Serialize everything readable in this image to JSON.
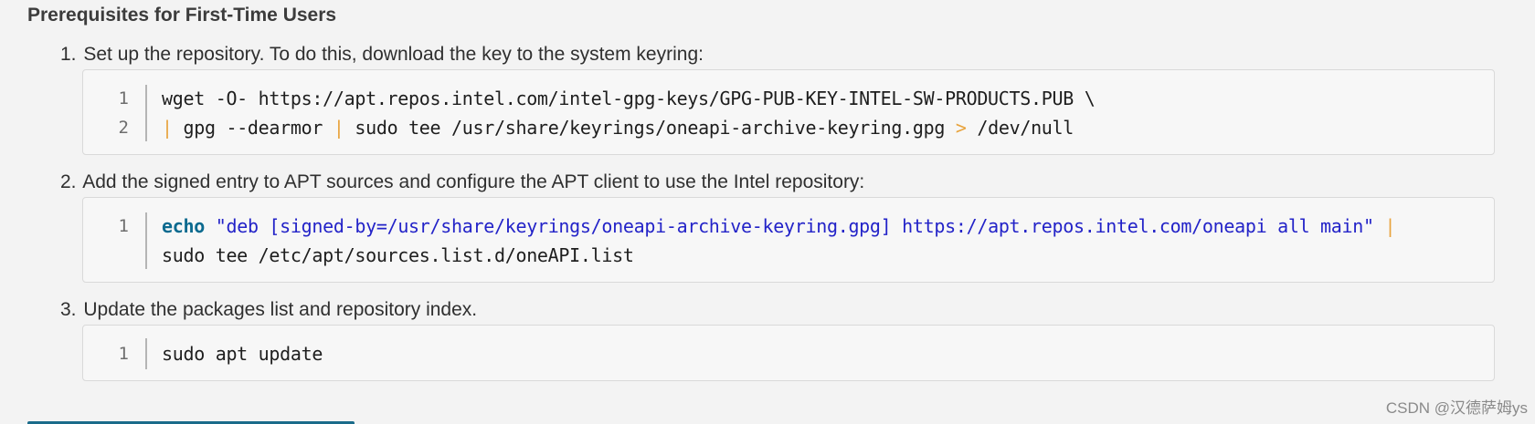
{
  "section": {
    "title": "Prerequisites for First-Time Users"
  },
  "steps": [
    {
      "number": "1.",
      "text": "Set up the repository. To do this, download the key to the system keyring:",
      "code": [
        {
          "ln": "1",
          "parts": [
            "wget -O- https://apt.repos.intel.com/intel-gpg-keys/GPG-PUB-KEY-INTEL-SW-PRODUCTS.PUB \\"
          ]
        },
        {
          "ln": "2",
          "parts": [
            "|",
            " gpg --dearmor ",
            "|",
            " sudo tee /usr/share/keyrings/oneapi-archive-keyring.gpg ",
            ">",
            " /dev/null"
          ]
        }
      ]
    },
    {
      "number": "2.",
      "text": "Add the signed entry to APT sources and configure the APT client to use the Intel repository:",
      "code": [
        {
          "ln": "1",
          "parts": [
            "echo",
            " ",
            "\"deb [signed-by=/usr/share/keyrings/oneapi-archive-keyring.gpg] https://apt.repos.intel.com/oneapi all main\"",
            " ",
            "|"
          ]
        },
        {
          "ln": "",
          "parts": [
            "sudo tee /etc/apt/sources.list.d/oneAPI.list"
          ]
        }
      ]
    },
    {
      "number": "3.",
      "text": "Update the packages list and repository index.",
      "code": [
        {
          "ln": "1",
          "parts": [
            "sudo apt update"
          ]
        }
      ]
    }
  ],
  "watermark": "CSDN @汉德萨姆ys",
  "colors": {
    "background": "#f3f3f3",
    "code_background": "#f7f7f7",
    "pipe_operator": "#e8a33d",
    "keyword": "#0b6a8f",
    "string": "#2323c8",
    "link_bar": "#1a6b8a"
  }
}
